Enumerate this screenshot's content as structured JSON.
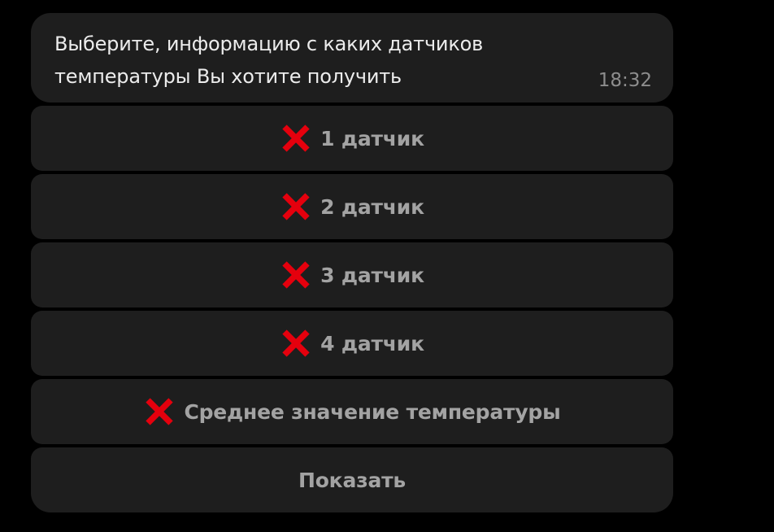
{
  "message": {
    "line1": "Выберите, информацию с каких датчиков",
    "line2": "температуры Вы хотите получить",
    "time": "18:32"
  },
  "keyboard": {
    "buttons": [
      {
        "icon": "cross-mark-icon",
        "label": "1 датчик"
      },
      {
        "icon": "cross-mark-icon",
        "label": "2 датчик"
      },
      {
        "icon": "cross-mark-icon",
        "label": "3 датчик"
      },
      {
        "icon": "cross-mark-icon",
        "label": "4 датчик"
      },
      {
        "icon": "cross-mark-icon",
        "label": "Среднее значение температуры"
      },
      {
        "icon": "",
        "label": "Показать"
      }
    ]
  },
  "colors": {
    "background": "#000000",
    "bubble": "#1e1e1e",
    "text": "#ececec",
    "muted": "#a3a3a3",
    "cross": "#e5000d"
  }
}
